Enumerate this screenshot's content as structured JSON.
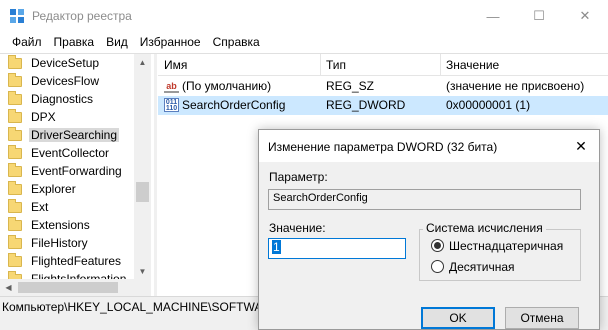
{
  "window": {
    "title": "Редактор реестра",
    "minimize_glyph": "—",
    "maximize_glyph": "☐",
    "close_glyph": "✕",
    "app_icon": "registry-editor-icon"
  },
  "menu": [
    "Файл",
    "Правка",
    "Вид",
    "Избранное",
    "Справка"
  ],
  "tree": {
    "items": [
      {
        "label": "DeviceSetup"
      },
      {
        "label": "DevicesFlow"
      },
      {
        "label": "Diagnostics"
      },
      {
        "label": "DPX"
      },
      {
        "label": "DriverSearching",
        "selected": true
      },
      {
        "label": "EventCollector"
      },
      {
        "label": "EventForwarding"
      },
      {
        "label": "Explorer"
      },
      {
        "label": "Ext"
      },
      {
        "label": "Extensions"
      },
      {
        "label": "FileHistory"
      },
      {
        "label": "FlightedFeatures"
      },
      {
        "label": "FlightsInformation"
      }
    ]
  },
  "list": {
    "columns": [
      "Имя",
      "Тип",
      "Значение"
    ],
    "rows": [
      {
        "icon": "string-value-icon",
        "icon_glyph": "ab",
        "name": "(По умолчанию)",
        "type": "REG_SZ",
        "value": "(значение не присвоено)",
        "selected": false
      },
      {
        "icon": "binary-value-icon",
        "icon_glyph": "011\n110",
        "name": "SearchOrderConfig",
        "type": "REG_DWORD",
        "value": "0x00000001 (1)",
        "selected": true
      }
    ]
  },
  "statusbar": {
    "path": "Компьютер\\HKEY_LOCAL_MACHINE\\SOFTWARE\\Microsoft\\Windows\\CurrentVersion\\DriverSearching"
  },
  "dialog": {
    "title": "Изменение параметра DWORD (32 бита)",
    "close_glyph": "✕",
    "param_label": "Параметр:",
    "param_value": "SearchOrderConfig",
    "value_label": "Значение:",
    "value": "1",
    "base_group_title": "Система исчисления",
    "base_options": [
      {
        "label": "Шестнадцатеричная",
        "checked": true
      },
      {
        "label": "Десятичная",
        "checked": false
      }
    ],
    "ok_label": "OK",
    "cancel_label": "Отмена"
  },
  "colors": {
    "selection_row": "#cce8ff",
    "focus_blue": "#0078d7",
    "folder": "#f7d774"
  }
}
